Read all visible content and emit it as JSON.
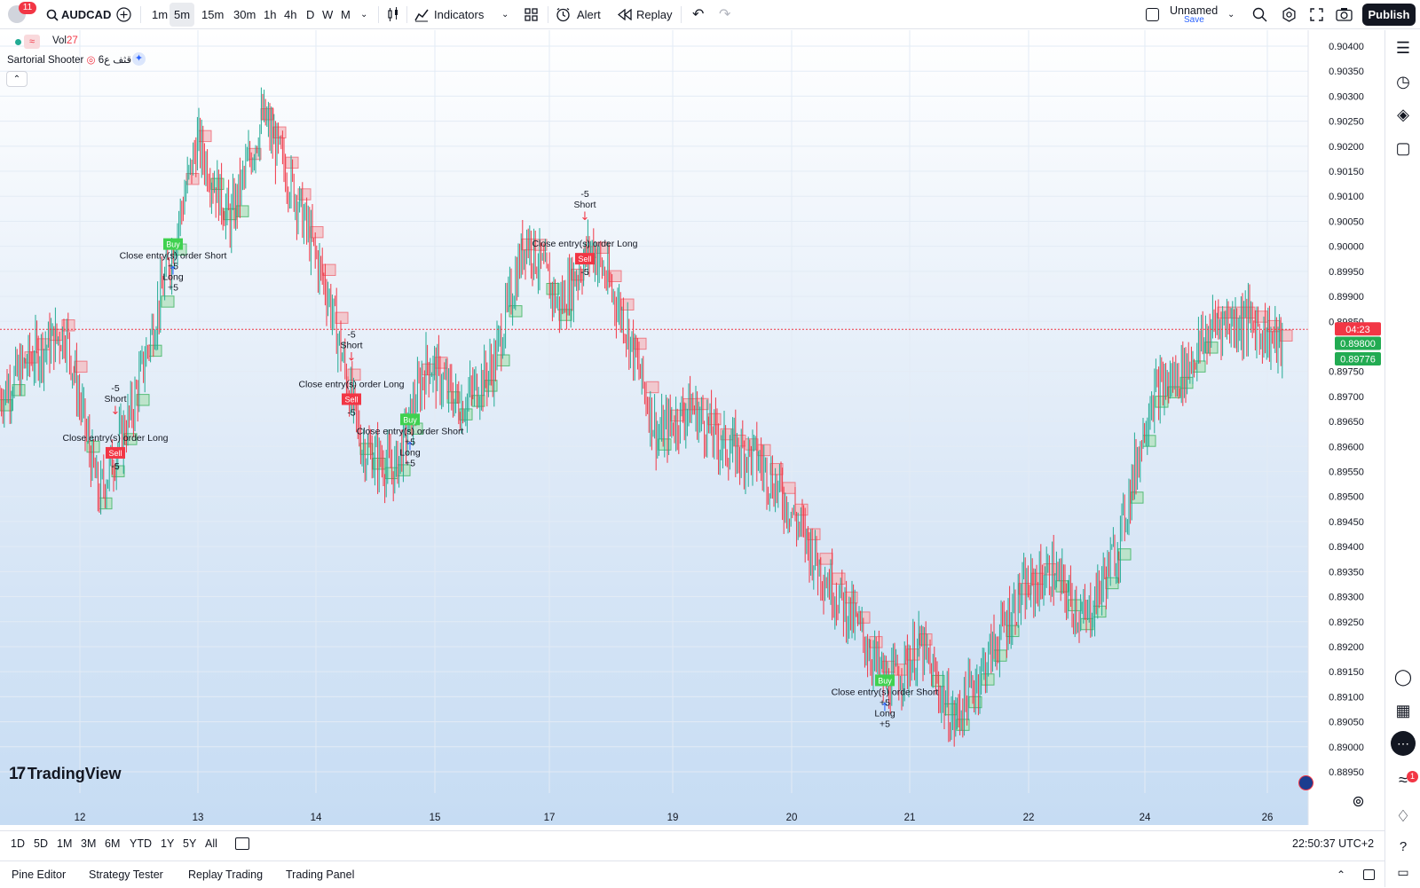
{
  "toolbar": {
    "notification_count": "11",
    "symbol": "AUDCAD",
    "timeframes": [
      "1m",
      "5m",
      "15m",
      "30m",
      "1h",
      "4h",
      "D",
      "W",
      "M"
    ],
    "active_timeframe": "5m",
    "indicators_label": "Indicators",
    "alert_label": "Alert",
    "replay_label": "Replay",
    "layout_name": "Unnamed",
    "layout_save": "Save",
    "publish_label": "Publish"
  },
  "legend": {
    "vol_label": "Vol",
    "vol_value": "27",
    "strategy_name": "Sartorial Shooter",
    "strategy_suffix": "6قثف ع"
  },
  "price_axis": {
    "ticks": [
      "0.90400",
      "0.90350",
      "0.90300",
      "0.90250",
      "0.90200",
      "0.90150",
      "0.90100",
      "0.90050",
      "0.90000",
      "0.89950",
      "0.89900",
      "0.89850",
      "0.89750",
      "0.89700",
      "0.89650",
      "0.89600",
      "0.89550",
      "0.89500",
      "0.89450",
      "0.89400",
      "0.89350",
      "0.89300",
      "0.89250",
      "0.89200",
      "0.89150",
      "0.89100",
      "0.89050",
      "0.89000",
      "0.88950"
    ],
    "countdown": "04:23",
    "last_price": "0.89800",
    "stop_price": "0.89776"
  },
  "time_axis": {
    "labels": [
      "12",
      "13",
      "14",
      "15",
      "17",
      "19",
      "20",
      "21",
      "22",
      "24",
      "26"
    ]
  },
  "bottom": {
    "ranges": [
      "1D",
      "5D",
      "1M",
      "3M",
      "6M",
      "YTD",
      "1Y",
      "5Y",
      "All"
    ],
    "clock": "22:50:37 UTC+2"
  },
  "panels": [
    "Pine Editor",
    "Strategy Tester",
    "Replay Trading",
    "Trading Panel"
  ],
  "brand": "TradingView",
  "alerts_badge": "1",
  "colors": {
    "up": "#22ab94",
    "down": "#f23645",
    "accent": "#2962ff",
    "long_band": "#b8e3c4",
    "short_band": "#f4c2c7"
  },
  "chart_data": {
    "type": "candlestick",
    "symbol": "AUDCAD",
    "interval": "5m",
    "ylim": [
      0.8891,
      0.9043
    ],
    "close_path": [
      [
        "12",
        0.897
      ],
      [
        "12",
        0.8978
      ],
      [
        "12",
        0.8983
      ],
      [
        "12",
        0.895
      ],
      [
        "13",
        0.8967
      ],
      [
        "13",
        0.8993
      ],
      [
        "13",
        0.9021
      ],
      [
        "13",
        0.9005
      ],
      [
        "14",
        0.9026
      ],
      [
        "14",
        0.901
      ],
      [
        "14",
        0.899
      ],
      [
        "14",
        0.896
      ],
      [
        "15",
        0.8955
      ],
      [
        "15",
        0.8977
      ],
      [
        "15",
        0.8968
      ],
      [
        "15",
        0.8976
      ],
      [
        "17",
        0.9002
      ],
      [
        "17",
        0.8988
      ],
      [
        "17",
        0.9
      ],
      [
        "17",
        0.8985
      ],
      [
        "19",
        0.8962
      ],
      [
        "19",
        0.8968
      ],
      [
        "19",
        0.896
      ],
      [
        "19",
        0.8958
      ],
      [
        "20",
        0.8948
      ],
      [
        "20",
        0.8935
      ],
      [
        "20",
        0.8925
      ],
      [
        "20",
        0.8912
      ],
      [
        "21",
        0.892
      ],
      [
        "21",
        0.8905
      ],
      [
        "21",
        0.8917
      ],
      [
        "21",
        0.893
      ],
      [
        "22",
        0.8935
      ],
      [
        "22",
        0.8925
      ],
      [
        "22",
        0.894
      ],
      [
        "22",
        0.897
      ],
      [
        "24",
        0.8975
      ],
      [
        "24",
        0.8985
      ],
      [
        "24",
        0.8985
      ],
      [
        "26",
        0.898
      ]
    ],
    "trades": [
      {
        "type": "short",
        "date": "12",
        "entry_label": "Short",
        "qty": "-5",
        "signal": "Sell",
        "close_label": "Close entry(s) order Long"
      },
      {
        "type": "long",
        "date": "13",
        "entry_label": "Long",
        "qty": "+5",
        "signal": "Buy",
        "close_label": "Close entry(s) order Short"
      },
      {
        "type": "short",
        "date": "14",
        "entry_label": "Short",
        "qty": "-5",
        "signal": "Sell",
        "close_label": "Close entry(s) order Long"
      },
      {
        "type": "long",
        "date": "15",
        "entry_label": "Long",
        "qty": "+5",
        "signal": "Buy",
        "close_label": "Close entry(s) order Short"
      },
      {
        "type": "short",
        "date": "17",
        "entry_label": "Short",
        "qty": "-5",
        "signal": "Sell",
        "close_label": "Close entry(s) order Long"
      },
      {
        "type": "long",
        "date": "21",
        "entry_label": "Long",
        "qty": "+5",
        "signal": "Buy",
        "close_label": "Close entry(s) order Short"
      }
    ]
  }
}
